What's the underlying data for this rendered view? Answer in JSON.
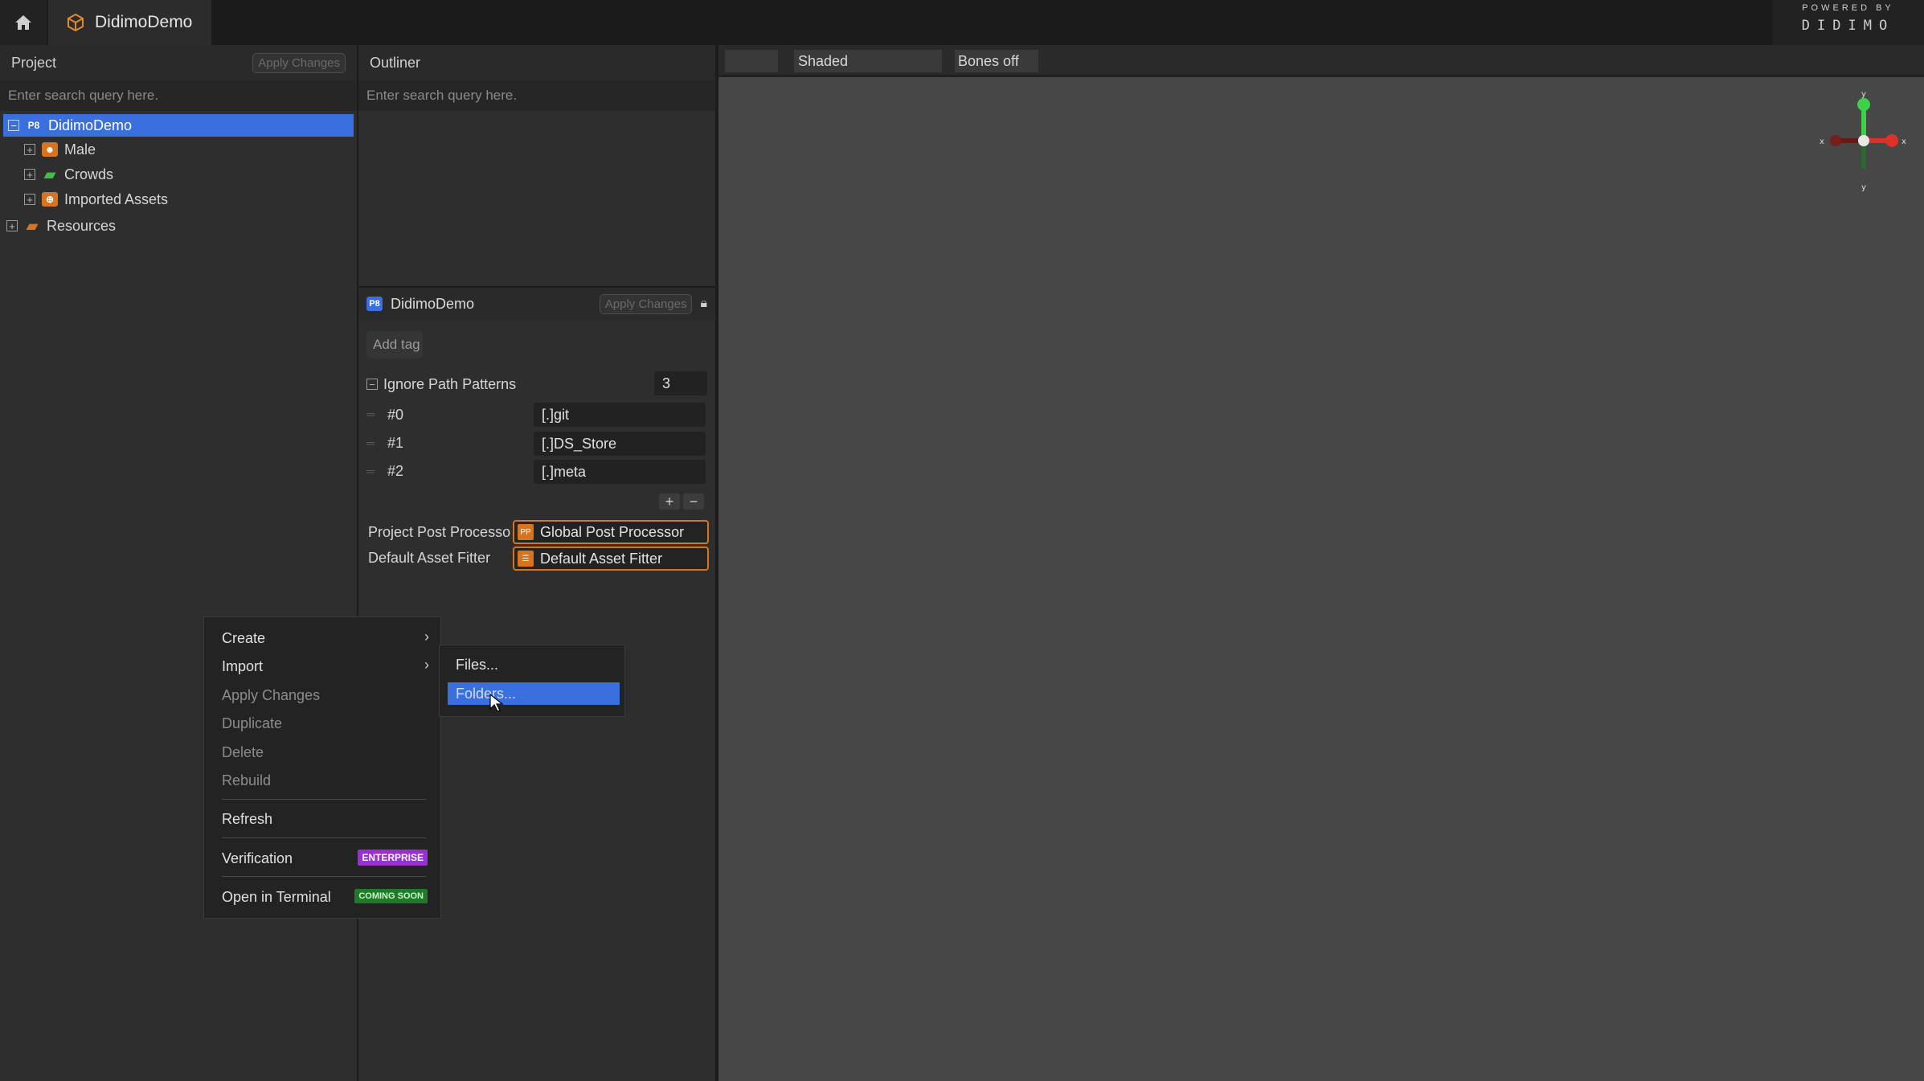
{
  "topbar": {
    "tab_title": "DidimoDemo",
    "powered_by": "POWERED BY",
    "brand": "DIDIMO"
  },
  "project": {
    "title": "Project",
    "apply_label": "Apply Changes",
    "search_placeholder": "Enter search query here.",
    "tree": [
      {
        "label": "DidimoDemo",
        "icon": "project-icon",
        "badge": "P8"
      },
      {
        "label": "Male",
        "icon": "person-icon"
      },
      {
        "label": "Crowds",
        "icon": "folder-green-icon"
      },
      {
        "label": "Imported Assets",
        "icon": "import-icon"
      },
      {
        "label": "Resources",
        "icon": "folder-orange-icon"
      }
    ]
  },
  "outliner": {
    "title": "Outliner",
    "search_placeholder": "Enter search query here."
  },
  "inspector": {
    "badge": "P8",
    "title": "DidimoDemo",
    "apply_label": "Apply Changes",
    "add_tag": "Add tag",
    "ignore_label": "Ignore Path Patterns",
    "ignore_count": "3",
    "patterns": [
      {
        "index": "#0",
        "value": "[.]git"
      },
      {
        "index": "#1",
        "value": "[.]DS_Store"
      },
      {
        "index": "#2",
        "value": "[.]meta"
      }
    ],
    "plus": "+",
    "minus": "−",
    "post_processor_label": "Project Post Processo",
    "post_processor_value": "Global Post Processor",
    "asset_filter_label": "Default Asset Fitter",
    "asset_filter_value": "Default Asset Fitter"
  },
  "viewport": {
    "shading": "Shaded",
    "bones": "Bones off",
    "gizmo_colors": {
      "x": "#e0302a",
      "y": "#3fd04a",
      "z": "#2a9a3a"
    }
  },
  "context_menu": {
    "items": [
      {
        "label": "Create"
      },
      {
        "label": "Import"
      },
      {
        "label": "Apply Changes"
      },
      {
        "label": "Duplicate"
      },
      {
        "label": "Delete"
      },
      {
        "label": "Rebuild"
      },
      {
        "label": "Refresh"
      },
      {
        "label": "Verification",
        "badge": "ENTERPRISE"
      },
      {
        "label": "Open in Terminal",
        "badge": "COMING SOON"
      }
    ],
    "submenu": [
      {
        "label": "Files..."
      },
      {
        "label": "Folders..."
      }
    ]
  }
}
